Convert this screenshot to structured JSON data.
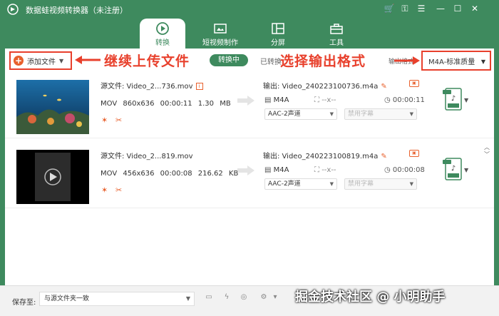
{
  "app": {
    "title": "数据蛙视频转换器（未注册）"
  },
  "nav": {
    "tabs": [
      {
        "label": "转换"
      },
      {
        "label": "短视频制作"
      },
      {
        "label": "分屏"
      },
      {
        "label": "工具"
      }
    ]
  },
  "toolbar": {
    "add_file_label": "添加文件",
    "converting_label": "转换中",
    "converted_label": "已转换",
    "output_format_label": "输出格式:",
    "output_format_value": "M4A-标准质量"
  },
  "annotations": {
    "left": "继续上传文件",
    "right": "选择输出格式"
  },
  "files": [
    {
      "source_label": "源文件: Video_2...736.mov",
      "format": "MOV",
      "resolution": "860x636",
      "duration": "00:00:11",
      "size": "1.30 MB",
      "output_label": "输出: Video_240223100736.m4a",
      "out_format": "M4A",
      "out_res": "--x--",
      "out_duration": "00:00:11",
      "audio": "AAC-2声道",
      "subtitle": "禁用字幕"
    },
    {
      "source_label": "源文件: Video_2...819.mov",
      "format": "MOV",
      "resolution": "456x636",
      "duration": "00:00:08",
      "size": "216.62 KB",
      "output_label": "输出: Video_240223100819.m4a",
      "out_format": "M4A",
      "out_res": "--x--",
      "out_duration": "00:00:08",
      "audio": "AAC-2声道",
      "subtitle": "禁用字幕"
    }
  ],
  "bottom": {
    "save_to_label": "保存至:",
    "save_path": "与源文件夹一致"
  },
  "watermark": {
    "text": "掘金技术社区 @ 小明助手"
  },
  "colors": {
    "brand": "#3e8a5e",
    "accent": "#e8602c",
    "annotation": "#e8402c"
  }
}
